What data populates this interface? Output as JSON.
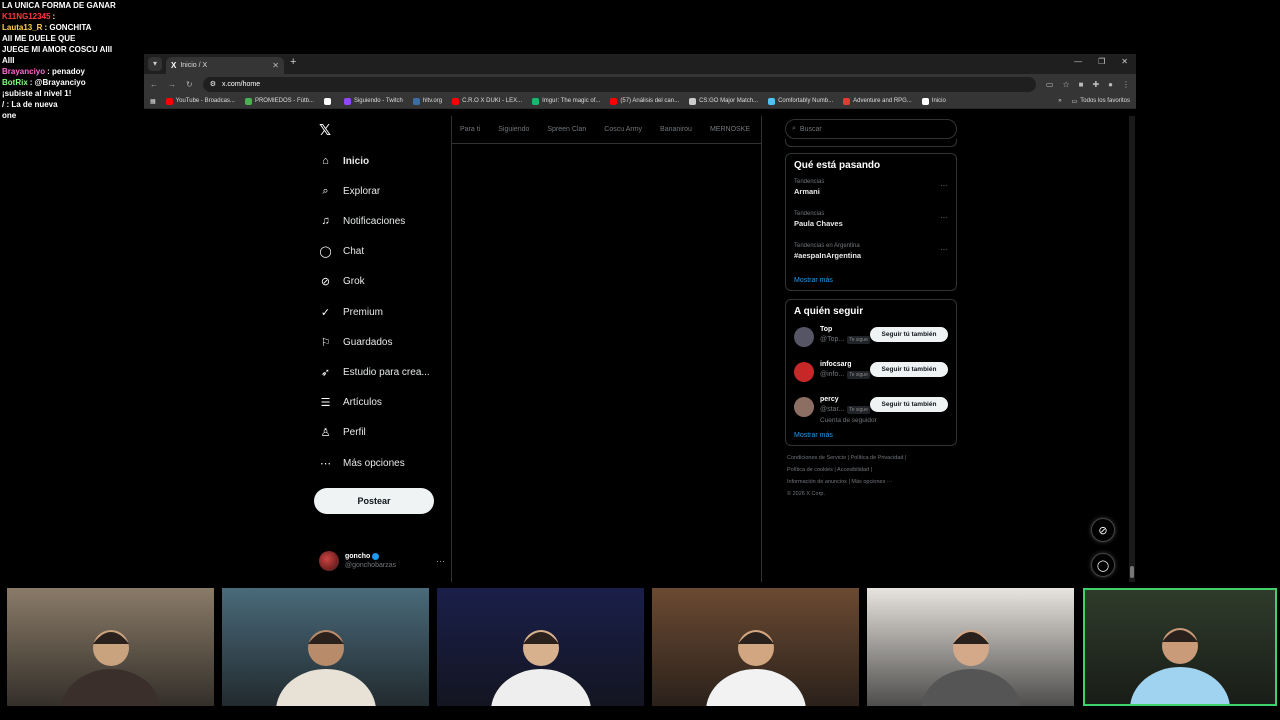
{
  "stream_chat": [
    {
      "user": "LA UNICA FORMA DE GANAR",
      "color": "#ffffff",
      "msg": ""
    },
    {
      "user": "K11NG12345",
      "color": "#ff3b3b",
      "msg": ":"
    },
    {
      "user": "Lauta13_R",
      "color": "#ffd54f",
      "msg": ": GONCHITA"
    },
    {
      "user": "",
      "color": "#ffffff",
      "msg": "AII ME DUELE QUE"
    },
    {
      "user": "",
      "color": "#ffffff",
      "msg": "JUEGE MI AMOR COSCU AIII"
    },
    {
      "user": "",
      "color": "#ffffff",
      "msg": "AIII"
    },
    {
      "user": "Brayanciyo",
      "color": "#ff6ad5",
      "msg": ": penadoy"
    },
    {
      "user": "BotRix",
      "color": "#7fff7f",
      "msg": ": @Brayanciyo"
    },
    {
      "user": "",
      "color": "#ffffff",
      "msg": "¡subiste al nivel 1!"
    },
    {
      "user": "",
      "color": "#ffffff",
      "msg": "/ : La de nueva"
    },
    {
      "user": "",
      "color": "#ffffff",
      "msg": "one"
    }
  ],
  "browser": {
    "tab_title": "Inicio / X",
    "url_path": "x.com/home",
    "bookmarks": [
      {
        "label": "YouTube - Broadcas...",
        "color": "#ff0000"
      },
      {
        "label": "PROMIEDOS - Fútb...",
        "color": "#4caf50"
      },
      {
        "label": "",
        "color": "#ffffff"
      },
      {
        "label": "Siguiendo - Twitch",
        "color": "#9146ff"
      },
      {
        "label": "hltv.org",
        "color": "#3b6ea5"
      },
      {
        "label": "C.R.O X DUKI - LEX...",
        "color": "#ff0000"
      },
      {
        "label": "Imgur: The magic of...",
        "color": "#1bb76e"
      },
      {
        "label": "(57) Análisis del can...",
        "color": "#ff0000"
      },
      {
        "label": "CS:GO Major Match...",
        "color": "#cccccc"
      },
      {
        "label": "Comfortably Numb...",
        "color": "#4fc3f7"
      },
      {
        "label": "Adventure and RPG...",
        "color": "#e53935"
      },
      {
        "label": "Inicio",
        "color": "#ffffff"
      }
    ],
    "all_bookmarks": "Todos los favoritos"
  },
  "x": {
    "nav": [
      {
        "label": "Inicio",
        "icon": "home-icon",
        "glyph": "⌂",
        "active": true
      },
      {
        "label": "Explorar",
        "icon": "search-icon",
        "glyph": "⌕"
      },
      {
        "label": "Notificaciones",
        "icon": "bell-icon",
        "glyph": "♫"
      },
      {
        "label": "Chat",
        "icon": "chat-icon",
        "glyph": "◯"
      },
      {
        "label": "Grok",
        "icon": "grok-icon",
        "glyph": "⊘"
      },
      {
        "label": "Premium",
        "icon": "premium-icon",
        "glyph": "✓"
      },
      {
        "label": "Guardados",
        "icon": "bookmark-icon",
        "glyph": "⚐"
      },
      {
        "label": "Estudio para crea...",
        "icon": "rocket-icon",
        "glyph": "➶"
      },
      {
        "label": "Artículos",
        "icon": "article-icon",
        "glyph": "☰"
      },
      {
        "label": "Perfil",
        "icon": "profile-icon",
        "glyph": "♙"
      },
      {
        "label": "Más opciones",
        "icon": "more-icon",
        "glyph": "⋯"
      }
    ],
    "post_label": "Postear",
    "account": {
      "name": "goncho",
      "handle": "@gonchobarzas"
    },
    "feed_tabs": [
      "Para ti",
      "Siguiendo",
      "Spreen Clan",
      "Coscu Army",
      "Bananirou",
      "MERNOSKE"
    ],
    "search_placeholder": "Buscar",
    "trending": {
      "title": "Qué está pasando",
      "items": [
        {
          "context": "Tendencias",
          "name": "Armani"
        },
        {
          "context": "Tendencias",
          "name": "Paula Chaves"
        },
        {
          "context": "Tendencias en Argentina",
          "name": "#aespaInArgentina"
        }
      ],
      "show_more": "Mostrar más"
    },
    "who_to_follow": {
      "title": "A quién seguir",
      "items": [
        {
          "name": "Top",
          "handle": "@Top...",
          "badge": "Te sigue",
          "button": "Seguir tú también",
          "sub": "",
          "avatar_color": "#556"
        },
        {
          "name": "infocsarg",
          "handle": "@info...",
          "badge": "Te sigue",
          "button": "Seguir tú también",
          "sub": "",
          "avatar_color": "#c62828"
        },
        {
          "name": "percy",
          "handle": "@star...",
          "badge": "Te sigue",
          "button": "Seguir tú también",
          "sub": "Cuenta de seguidor",
          "avatar_color": "#8d6e63"
        }
      ],
      "show_more": "Mostrar más"
    },
    "footer": [
      "Condiciones de Servicio  |  Política de Privacidad  |",
      "Política de cookies  |  Accesibilidad  |",
      "Información de anuncios  |  Más opciones ···",
      "© 2026 X Corp."
    ]
  },
  "webcams": [
    {
      "bg": "#8a7b68",
      "shirt": "#3a2f2a",
      "skin": "#c9a27e"
    },
    {
      "bg": "#4a6a7a",
      "shirt": "#e8e2d6",
      "skin": "#b88b6a"
    },
    {
      "bg": "#1a1f4a",
      "shirt": "#eeeeee",
      "skin": "#d7b08e"
    },
    {
      "bg": "#6b4a32",
      "shirt": "#f2f2f2",
      "skin": "#d2a680"
    },
    {
      "bg": "#e8e4df",
      "shirt": "#555555",
      "skin": "#d4a98a"
    },
    {
      "bg": "#2e3b2a",
      "shirt": "#9fd3f0",
      "skin": "#c99b78"
    }
  ]
}
